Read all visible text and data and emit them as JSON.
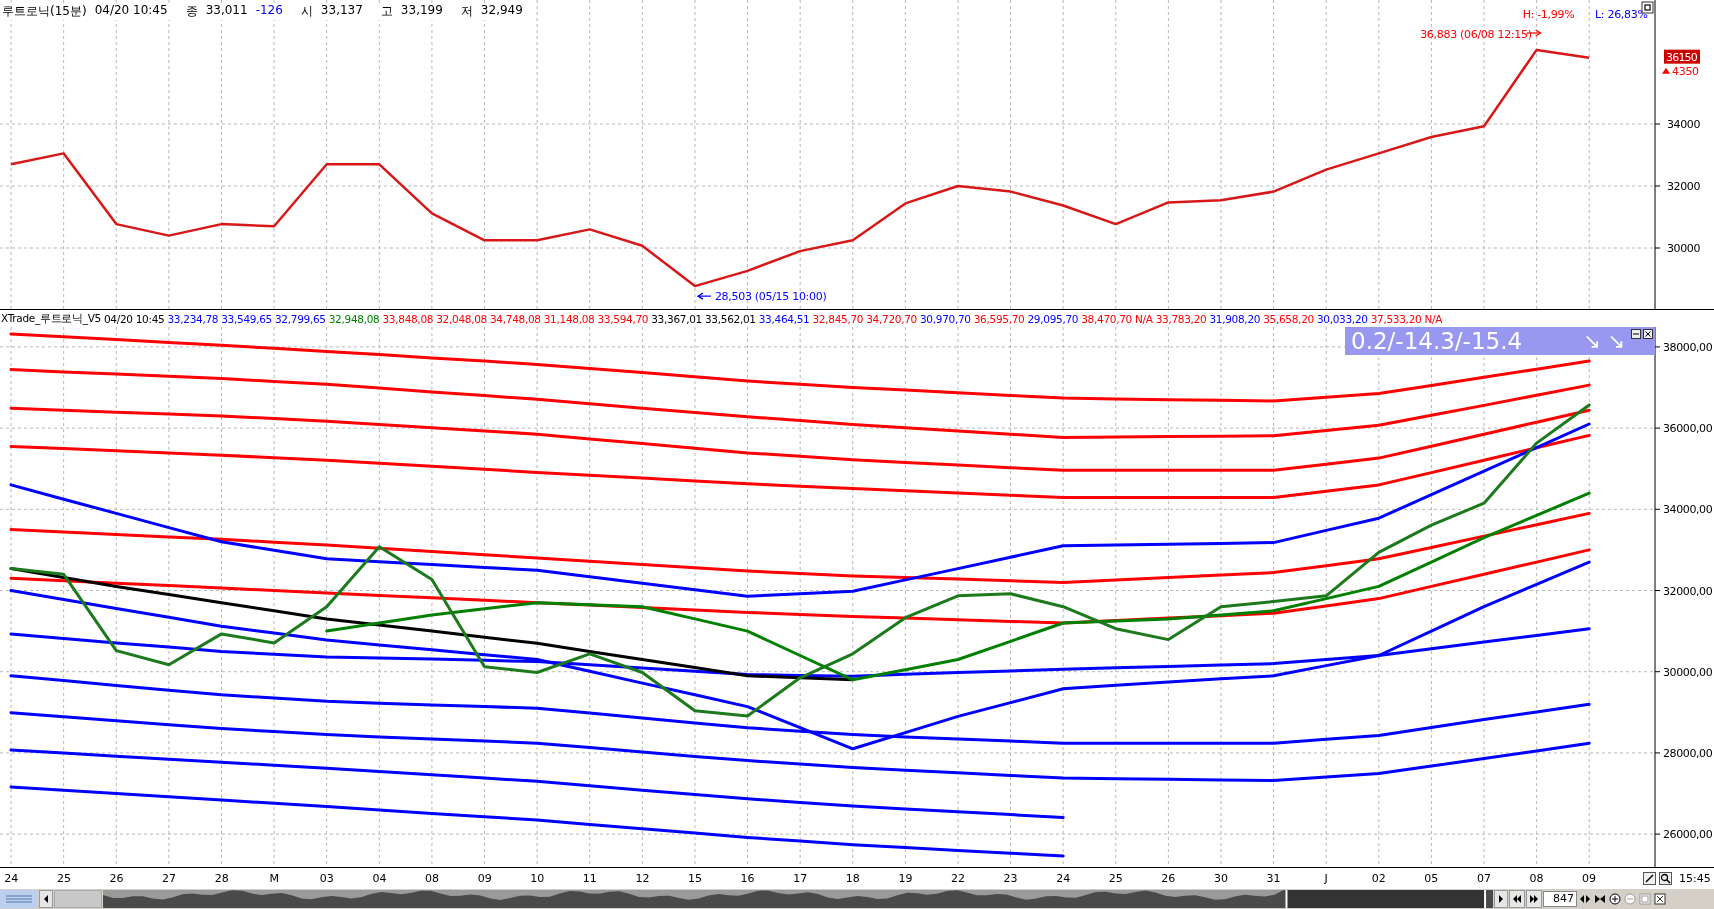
{
  "price_pane": {
    "header": {
      "title": "루트로닉(15분)",
      "datetime": "04/20 10:45",
      "fields": [
        {
          "label": "종",
          "value": "33,011",
          "change": "-126"
        },
        {
          "label": "시",
          "value": "33,137"
        },
        {
          "label": "고",
          "value": "33,199"
        },
        {
          "label": "저",
          "value": "32,949"
        }
      ]
    },
    "chart_data": {
      "type": "line",
      "grid": true,
      "categories": [
        null,
        null,
        null,
        null,
        null,
        null,
        null,
        null,
        null,
        null,
        null,
        null,
        null,
        null,
        null,
        null,
        null,
        null,
        null,
        null,
        null,
        null,
        null,
        null,
        null,
        null,
        null,
        null,
        null,
        null,
        null
      ],
      "ylim": [
        28000,
        38000
      ],
      "yticks": [
        30000,
        32000,
        34000
      ],
      "series": [
        {
          "color": "#d81818",
          "values": [
            32700,
            33050,
            30770,
            30400,
            30770,
            30700,
            32700,
            32700,
            31120,
            30250,
            30250,
            30600,
            30070,
            28770,
            29260,
            29900,
            30250,
            31440,
            32000,
            31820,
            31370,
            30770,
            31470,
            31540,
            31820,
            32530,
            33050,
            33580,
            33930,
            36390,
            36140
          ]
        }
      ]
    },
    "high_mark": "36,883 (06/08 12:15)",
    "high_pct": "H: -1,99%",
    "low_pct": "L: 26,83%",
    "low_mark": "28,503 (05/15 10:00)",
    "last_price": "36150",
    "last_change": "4350"
  },
  "indicator_pane": {
    "title": "XTrade_루트로닉_V5",
    "datetime": "04/20 10:45",
    "values": [
      {
        "text": "33,234,78",
        "color": "#0000ff"
      },
      {
        "text": "33,549,65",
        "color": "#0000ff"
      },
      {
        "text": "32,799,65",
        "color": "#0000ff"
      },
      {
        "text": "32,948,08",
        "color": "#008000"
      },
      {
        "text": "33,848,08",
        "color": "#ff0000"
      },
      {
        "text": "32,048,08",
        "color": "#ff0000"
      },
      {
        "text": "34,748,08",
        "color": "#ff0000"
      },
      {
        "text": "31,148,08",
        "color": "#ff0000"
      },
      {
        "text": "33,594,70",
        "color": "#ff0000"
      },
      {
        "text": "33,367,01",
        "color": "#000000"
      },
      {
        "text": "33,562,01",
        "color": "#000000"
      },
      {
        "text": "33,464,51",
        "color": "#0000ff"
      },
      {
        "text": "32,845,70",
        "color": "#ff0000"
      },
      {
        "text": "34,720,70",
        "color": "#ff0000"
      },
      {
        "text": "30,970,70",
        "color": "#0000ff"
      },
      {
        "text": "36,595,70",
        "color": "#ff0000"
      },
      {
        "text": "29,095,70",
        "color": "#0000ff"
      },
      {
        "text": "38,470,70",
        "color": "#ff0000"
      },
      {
        "text": "N/A",
        "color": "#ff0000"
      },
      {
        "text": "33,783,20",
        "color": "#ff0000"
      },
      {
        "text": "31,908,20",
        "color": "#0000ff"
      },
      {
        "text": "35,658,20",
        "color": "#ff0000"
      },
      {
        "text": "30,033,20",
        "color": "#0000ff"
      },
      {
        "text": "37,533,20",
        "color": "#ff0000"
      },
      {
        "text": "N/A",
        "color": "#ff0000"
      }
    ],
    "signal": {
      "text": "0.2/-14.3/-15.4",
      "arrows": "↘ ↘"
    },
    "chart_data": {
      "type": "line",
      "grid": true,
      "categories": [
        "24",
        "25",
        "26",
        "27",
        "28",
        "M",
        "03",
        "04",
        "08",
        "09",
        "10",
        "11",
        "12",
        "15",
        "16",
        "17",
        "18",
        "19",
        "22",
        "23",
        "24",
        "25",
        "26",
        "30",
        "31",
        "J",
        "02",
        "05",
        "07",
        "08",
        "09"
      ],
      "ylim": [
        25190,
        38490
      ],
      "yticks": [
        {
          "value": 26000,
          "label": "26000,00"
        },
        {
          "value": 28000,
          "label": "28000,00"
        },
        {
          "value": 30000,
          "label": "30000,00"
        },
        {
          "value": 32000,
          "label": "32000,00"
        },
        {
          "value": 34000,
          "label": "34000,00"
        },
        {
          "value": 36000,
          "label": "36000,00"
        },
        {
          "value": 38000,
          "label": "38000,00"
        }
      ],
      "series": [
        {
          "color": "#ff0000",
          "values": [
            38320,
            38250,
            38180,
            38110,
            38040,
            37965,
            37890,
            37810,
            37730,
            37650,
            37570,
            37470,
            37370,
            37265,
            37160,
            37080,
            37000,
            36935,
            36870,
            36805,
            36740,
            36720,
            36700,
            36685,
            36670,
            36760,
            36850,
            37050,
            37250,
            37450,
            37650
          ]
        },
        {
          "color": "#ff0000",
          "values": [
            37440,
            37385,
            37330,
            37275,
            37220,
            37150,
            37080,
            36985,
            36890,
            36800,
            36710,
            36600,
            36490,
            36385,
            36280,
            36185,
            36090,
            36010,
            35930,
            35850,
            35770,
            35780,
            35790,
            35800,
            35810,
            35940,
            36070,
            36315,
            36560,
            36810,
            37060
          ]
        },
        {
          "color": "#ff0000",
          "values": [
            36490,
            36440,
            36390,
            36345,
            36300,
            36235,
            36170,
            36090,
            36010,
            35930,
            35850,
            35735,
            35620,
            35505,
            35390,
            35305,
            35220,
            35155,
            35090,
            35025,
            34960,
            34960,
            34960,
            34960,
            34960,
            35110,
            35260,
            35555,
            35850,
            36145,
            36440
          ]
        },
        {
          "color": "#ff0000",
          "values": [
            35550,
            35495,
            35440,
            35385,
            35330,
            35270,
            35210,
            35135,
            35060,
            34985,
            34910,
            34840,
            34770,
            34700,
            34630,
            34570,
            34510,
            34455,
            34400,
            34345,
            34290,
            34290,
            34290,
            34290,
            34290,
            34445,
            34600,
            34905,
            35210,
            35515,
            35820
          ]
        },
        {
          "color": "#ff0000",
          "values": [
            33500,
            33440,
            33380,
            33320,
            33260,
            33190,
            33120,
            33040,
            32960,
            32880,
            32800,
            32720,
            32640,
            32560,
            32480,
            32420,
            32360,
            32320,
            32280,
            32240,
            32200,
            32260,
            32320,
            32380,
            32440,
            32610,
            32780,
            33060,
            33340,
            33620,
            33900
          ]
        },
        {
          "color": "#ff0000",
          "values": [
            32300,
            32240,
            32180,
            32120,
            32060,
            32000,
            31940,
            31880,
            31820,
            31760,
            31700,
            31640,
            31580,
            31520,
            31460,
            31410,
            31360,
            31320,
            31280,
            31240,
            31200,
            31260,
            31320,
            31380,
            31440,
            31620,
            31800,
            32100,
            32400,
            32700,
            33000
          ]
        },
        {
          "color": "#0000ff",
          "values": [
            34600,
            34250,
            33900,
            33550,
            33200,
            32990,
            32780,
            32710,
            32640,
            32570,
            32500,
            32340,
            32180,
            32020,
            31860,
            31920,
            31980,
            32260,
            32540,
            32820,
            33100,
            33120,
            33140,
            33160,
            33180,
            33480,
            33780,
            34360,
            34940,
            35520,
            36100
          ]
        },
        {
          "color": "#0000ff",
          "values": [
            30930,
            30820,
            30710,
            30605,
            30500,
            30430,
            30360,
            30335,
            30310,
            30280,
            30250,
            30170,
            30090,
            30010,
            29930,
            29910,
            29890,
            29935,
            29980,
            30020,
            30060,
            30095,
            30130,
            30165,
            30200,
            30300,
            30400,
            30565,
            30730,
            30895,
            31060
          ]
        },
        {
          "color": "#0000ff",
          "values": [
            29900,
            29780,
            29660,
            29545,
            29430,
            29350,
            29270,
            29225,
            29180,
            29140,
            29100,
            28980,
            28860,
            28740,
            28620,
            28535,
            28450,
            28395,
            28340,
            28290,
            28240,
            28240,
            28240,
            28240,
            28240,
            28335,
            28430,
            28625,
            28820,
            29010,
            29200
          ]
        },
        {
          "color": "#0000ff",
          "values": [
            28990,
            28890,
            28790,
            28695,
            28600,
            28525,
            28450,
            28395,
            28340,
            28290,
            28240,
            28130,
            28020,
            27915,
            27810,
            27725,
            27640,
            27575,
            27510,
            27445,
            27380,
            27365,
            27350,
            27335,
            27320,
            27405,
            27490,
            27675,
            27860,
            28050,
            28240
          ]
        },
        {
          "color": "#0000ff",
          "values": [
            28070,
            27995,
            27920,
            27845,
            27770,
            27695,
            27620,
            27540,
            27460,
            27380,
            27300,
            27190,
            27080,
            26975,
            26870,
            26780,
            26690,
            26620,
            26550,
            26480,
            26410,
            null,
            null,
            null,
            null,
            null,
            null,
            null,
            null,
            null,
            null
          ]
        },
        {
          "color": "#0000ff",
          "values": [
            27160,
            27080,
            27000,
            26920,
            26840,
            26760,
            26680,
            26595,
            26510,
            26430,
            26350,
            26240,
            26130,
            26025,
            25920,
            25830,
            25740,
            25670,
            25600,
            25530,
            25460,
            null,
            null,
            null,
            null,
            null,
            null,
            null,
            null,
            null,
            null
          ]
        },
        {
          "color": "#0000ff",
          "values": [
            32000,
            31780,
            31560,
            31340,
            31120,
            30950,
            30780,
            30660,
            30540,
            30420,
            30300,
            30010,
            29720,
            29430,
            29140,
            28620,
            28100,
            28500,
            28900,
            29240,
            29580,
            29665,
            29750,
            29825,
            29900,
            30150,
            30400,
            31000,
            31600,
            32150,
            32700
          ]
        },
        {
          "color": "#000000",
          "values": [
            32540,
            32320,
            32100,
            31900,
            31700,
            31500,
            31300,
            31150,
            31000,
            30850,
            30700,
            30500,
            30300,
            30100,
            29900,
            29850,
            29800,
            null,
            null,
            null,
            null,
            null,
            null,
            null,
            null,
            null,
            null,
            null,
            null,
            null,
            null
          ]
        },
        {
          "color": "#008000",
          "values": [
            null,
            null,
            null,
            null,
            null,
            null,
            31000,
            31200,
            31400,
            31550,
            31700,
            31650,
            31600,
            31300,
            31000,
            30400,
            29800,
            30050,
            30300,
            30750,
            31200,
            31250,
            31300,
            31400,
            31500,
            31800,
            32100,
            32700,
            33300,
            33850,
            34400
          ]
        },
        {
          "color": "#1c7a1c",
          "values": [
            32540,
            32400,
            30520,
            30170,
            30930,
            30710,
            31600,
            33080,
            32270,
            30120,
            29980,
            30440,
            29980,
            29040,
            28910,
            29850,
            30440,
            31330,
            31870,
            31920,
            31600,
            31060,
            30790,
            31600,
            31730,
            31870,
            32940,
            33610,
            34150,
            35630,
            36570
          ]
        }
      ]
    }
  },
  "time_axis": {
    "time": "15:45"
  },
  "scrollbar": {
    "count": "847"
  }
}
